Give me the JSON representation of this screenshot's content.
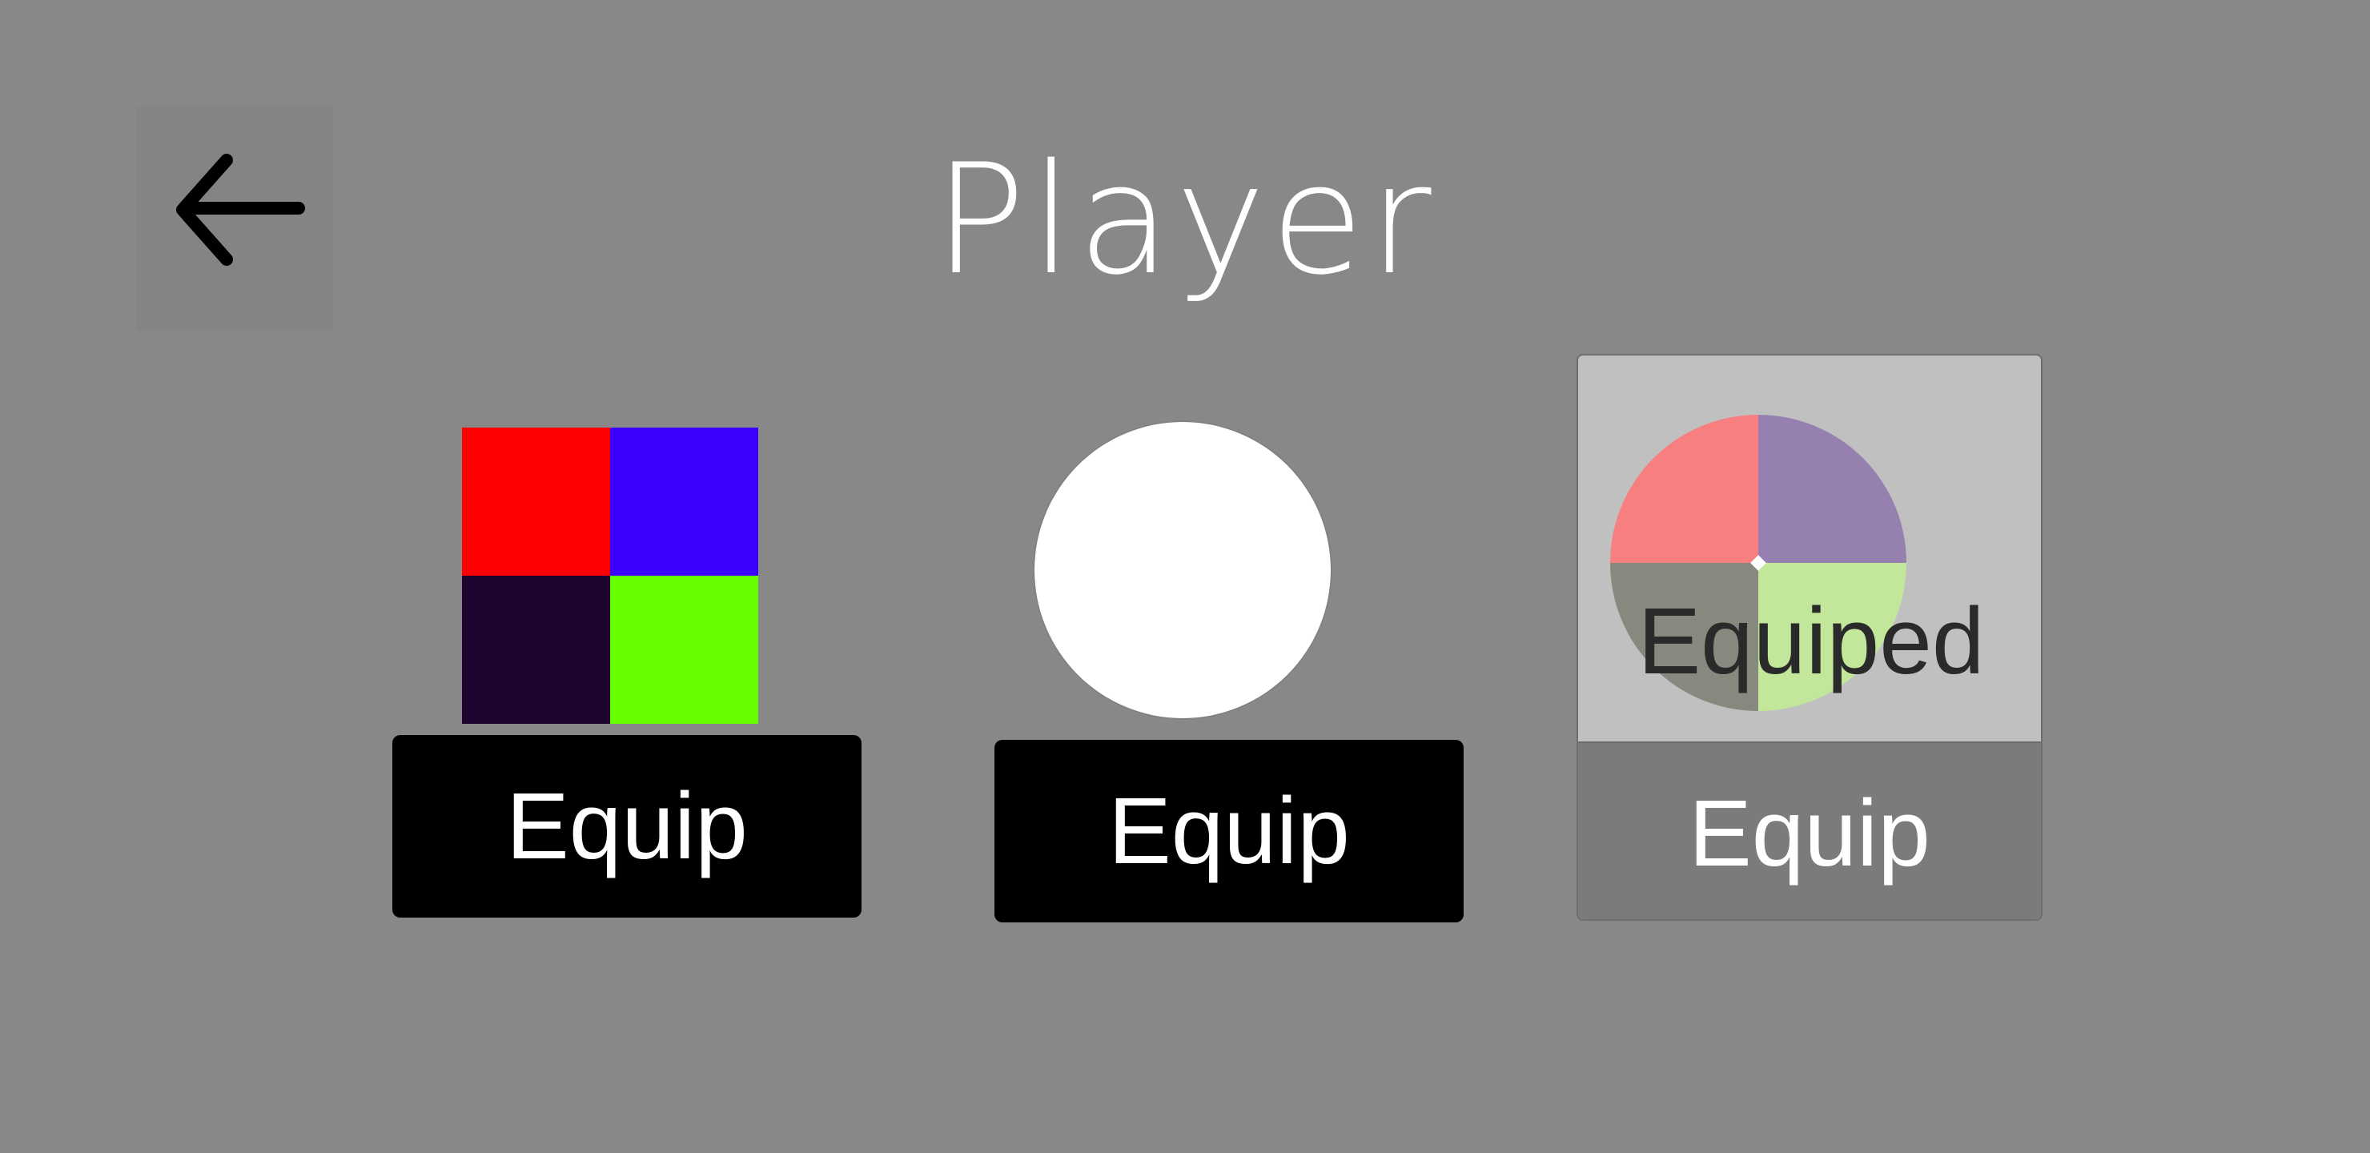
{
  "header": {
    "title": "Player",
    "back_icon": "arrow-left-icon"
  },
  "items": [
    {
      "preview": "four-color-square",
      "colors": [
        "#ff0000",
        "#3c00ff",
        "#1e0430",
        "#66ff00"
      ],
      "button_label": "Equip",
      "equipped": false
    },
    {
      "preview": "white-circle",
      "colors": [
        "#ffffff"
      ],
      "button_label": "Equip",
      "equipped": false
    },
    {
      "preview": "four-color-circle",
      "colors": [
        "#f77f7f",
        "#9680b0",
        "#868a7e",
        "#c2e69a"
      ],
      "button_label": "Equip",
      "status_label": "Equiped",
      "equipped": true
    }
  ],
  "colors": {
    "background": "#888888",
    "button": "#000000",
    "button_disabled": "#7b7b7b",
    "selected_card": "#c0c0c0"
  }
}
